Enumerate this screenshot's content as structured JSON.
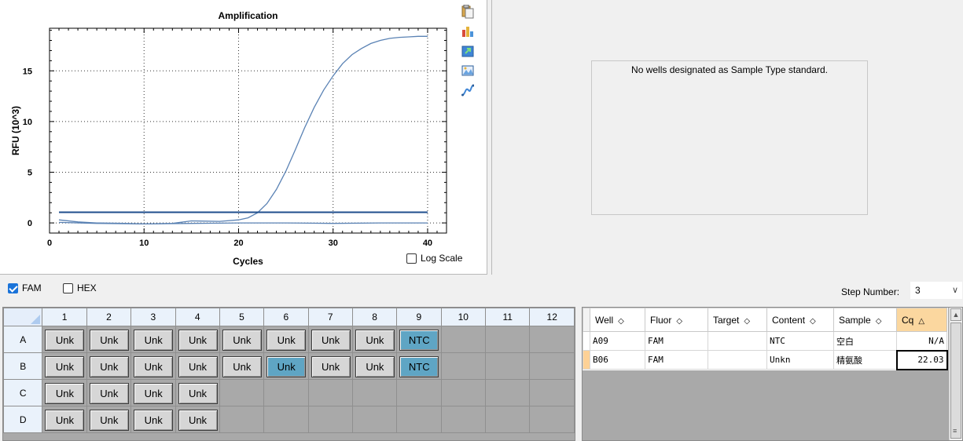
{
  "chart": {
    "tools": [
      "copy-icon",
      "chart-settings-icon",
      "export-icon",
      "image-icon",
      "curve-icon"
    ],
    "log_scale_label": "Log Scale",
    "log_scale_checked": false
  },
  "chart_data": {
    "type": "line",
    "title": "Amplification",
    "xlabel": "Cycles",
    "ylabel": "RFU (10^3)",
    "xlim": [
      0,
      42
    ],
    "ylim": [
      -1,
      19.2
    ],
    "xticks": [
      0,
      10,
      20,
      30,
      40
    ],
    "yticks": [
      0,
      5,
      10,
      15
    ],
    "grid": "dotted",
    "threshold": 1.05,
    "series": [
      {
        "color": "#5a82b4",
        "x": [
          1,
          3,
          5,
          8,
          10,
          13,
          15,
          18,
          20,
          21,
          22,
          23,
          24,
          25,
          26,
          27,
          28,
          29,
          30,
          31,
          32,
          33,
          34,
          35,
          36,
          37,
          38,
          39,
          40
        ],
        "y": [
          0.3,
          0.1,
          0.0,
          -0.05,
          -0.1,
          -0.05,
          0.2,
          0.15,
          0.3,
          0.5,
          1.0,
          1.9,
          3.3,
          5.1,
          7.2,
          9.4,
          11.4,
          13.1,
          14.5,
          15.7,
          16.6,
          17.2,
          17.7,
          18.0,
          18.2,
          18.3,
          18.35,
          18.4,
          18.4
        ]
      },
      {
        "color": "#5a82b4",
        "x": [
          1,
          5,
          10,
          15,
          20,
          25,
          30,
          35,
          40
        ],
        "y": [
          0.05,
          -0.05,
          -0.1,
          -0.05,
          0.0,
          0.0,
          -0.05,
          0.0,
          0.0
        ]
      }
    ]
  },
  "std_panel": {
    "message": "No wells designated as Sample Type standard."
  },
  "fluor_bar": {
    "fam_label": "FAM",
    "fam_checked": true,
    "hex_label": "HEX",
    "hex_checked": false,
    "step_label": "Step Number:",
    "step_value": "3"
  },
  "plate": {
    "columns": [
      "1",
      "2",
      "3",
      "4",
      "5",
      "6",
      "7",
      "8",
      "9",
      "10",
      "11",
      "12"
    ],
    "rows": [
      {
        "label": "A",
        "wells": [
          "Unk",
          "Unk",
          "Unk",
          "Unk",
          "Unk",
          "Unk",
          "Unk",
          "Unk",
          "NTC",
          "",
          "",
          ""
        ]
      },
      {
        "label": "B",
        "wells": [
          "Unk",
          "Unk",
          "Unk",
          "Unk",
          "Unk",
          "Unk",
          "Unk",
          "Unk",
          "NTC",
          "",
          "",
          ""
        ]
      },
      {
        "label": "C",
        "wells": [
          "Unk",
          "Unk",
          "Unk",
          "Unk",
          "",
          "",
          "",
          "",
          "",
          "",
          "",
          ""
        ]
      },
      {
        "label": "D",
        "wells": [
          "Unk",
          "Unk",
          "Unk",
          "Unk",
          "",
          "",
          "",
          "",
          "",
          "",
          "",
          ""
        ]
      }
    ]
  },
  "results": {
    "headers": {
      "well": "Well",
      "fluor": "Fluor",
      "target": "Target",
      "content": "Content",
      "sample": "Sample",
      "cq": "Cq"
    },
    "rows": [
      {
        "well": "A09",
        "fluor": "FAM",
        "target": "",
        "content": "NTC",
        "sample": "空白",
        "cq": "N/A"
      },
      {
        "well": "B06",
        "fluor": "FAM",
        "target": "",
        "content": "Unkn",
        "sample": "精氨酸",
        "cq": "22.03"
      }
    ]
  },
  "colors": {
    "curve": "#5a82b4",
    "threshold": "#1f4e8c",
    "well_default": "#d6d6d6",
    "well_highlight": "#5fa5c4",
    "cq_header": "#fbd79f"
  }
}
